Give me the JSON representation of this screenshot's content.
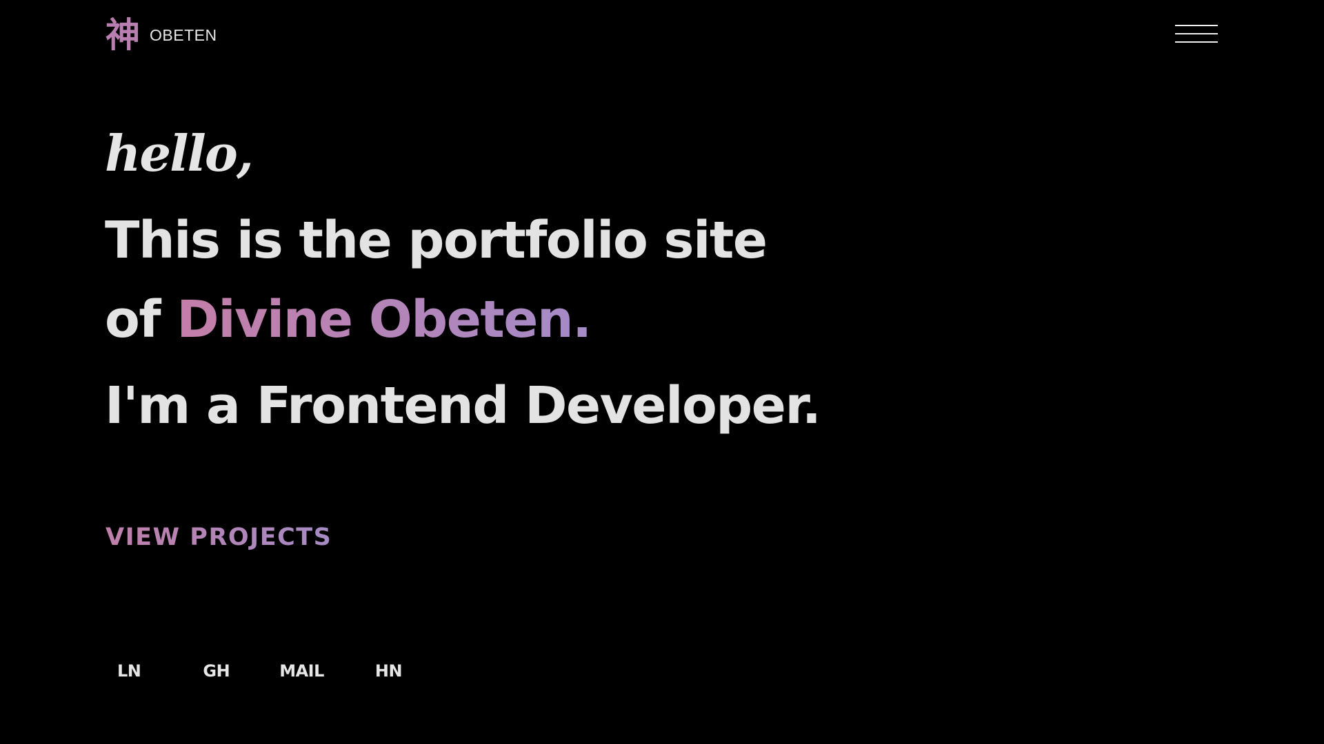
{
  "header": {
    "logo_glyph": "神",
    "logo_text": "OBETEN",
    "menu_icon": "hamburger-menu-icon"
  },
  "hero": {
    "greeting": "hello,",
    "line1": "This is the portfolio site",
    "line2_prefix": "of ",
    "line2_name": "Divine Obeten.",
    "line3": "I'm a Frontend Developer.",
    "cta_label": "VIEW PROJECTS"
  },
  "social": {
    "links": [
      {
        "label": "LN"
      },
      {
        "label": "GH"
      },
      {
        "label": "MAIL"
      },
      {
        "label": "HN"
      }
    ]
  },
  "colors": {
    "background": "#000000",
    "text": "#e3e3e3",
    "accent_start": "#c47ea8",
    "accent_end": "#a58bc7"
  }
}
